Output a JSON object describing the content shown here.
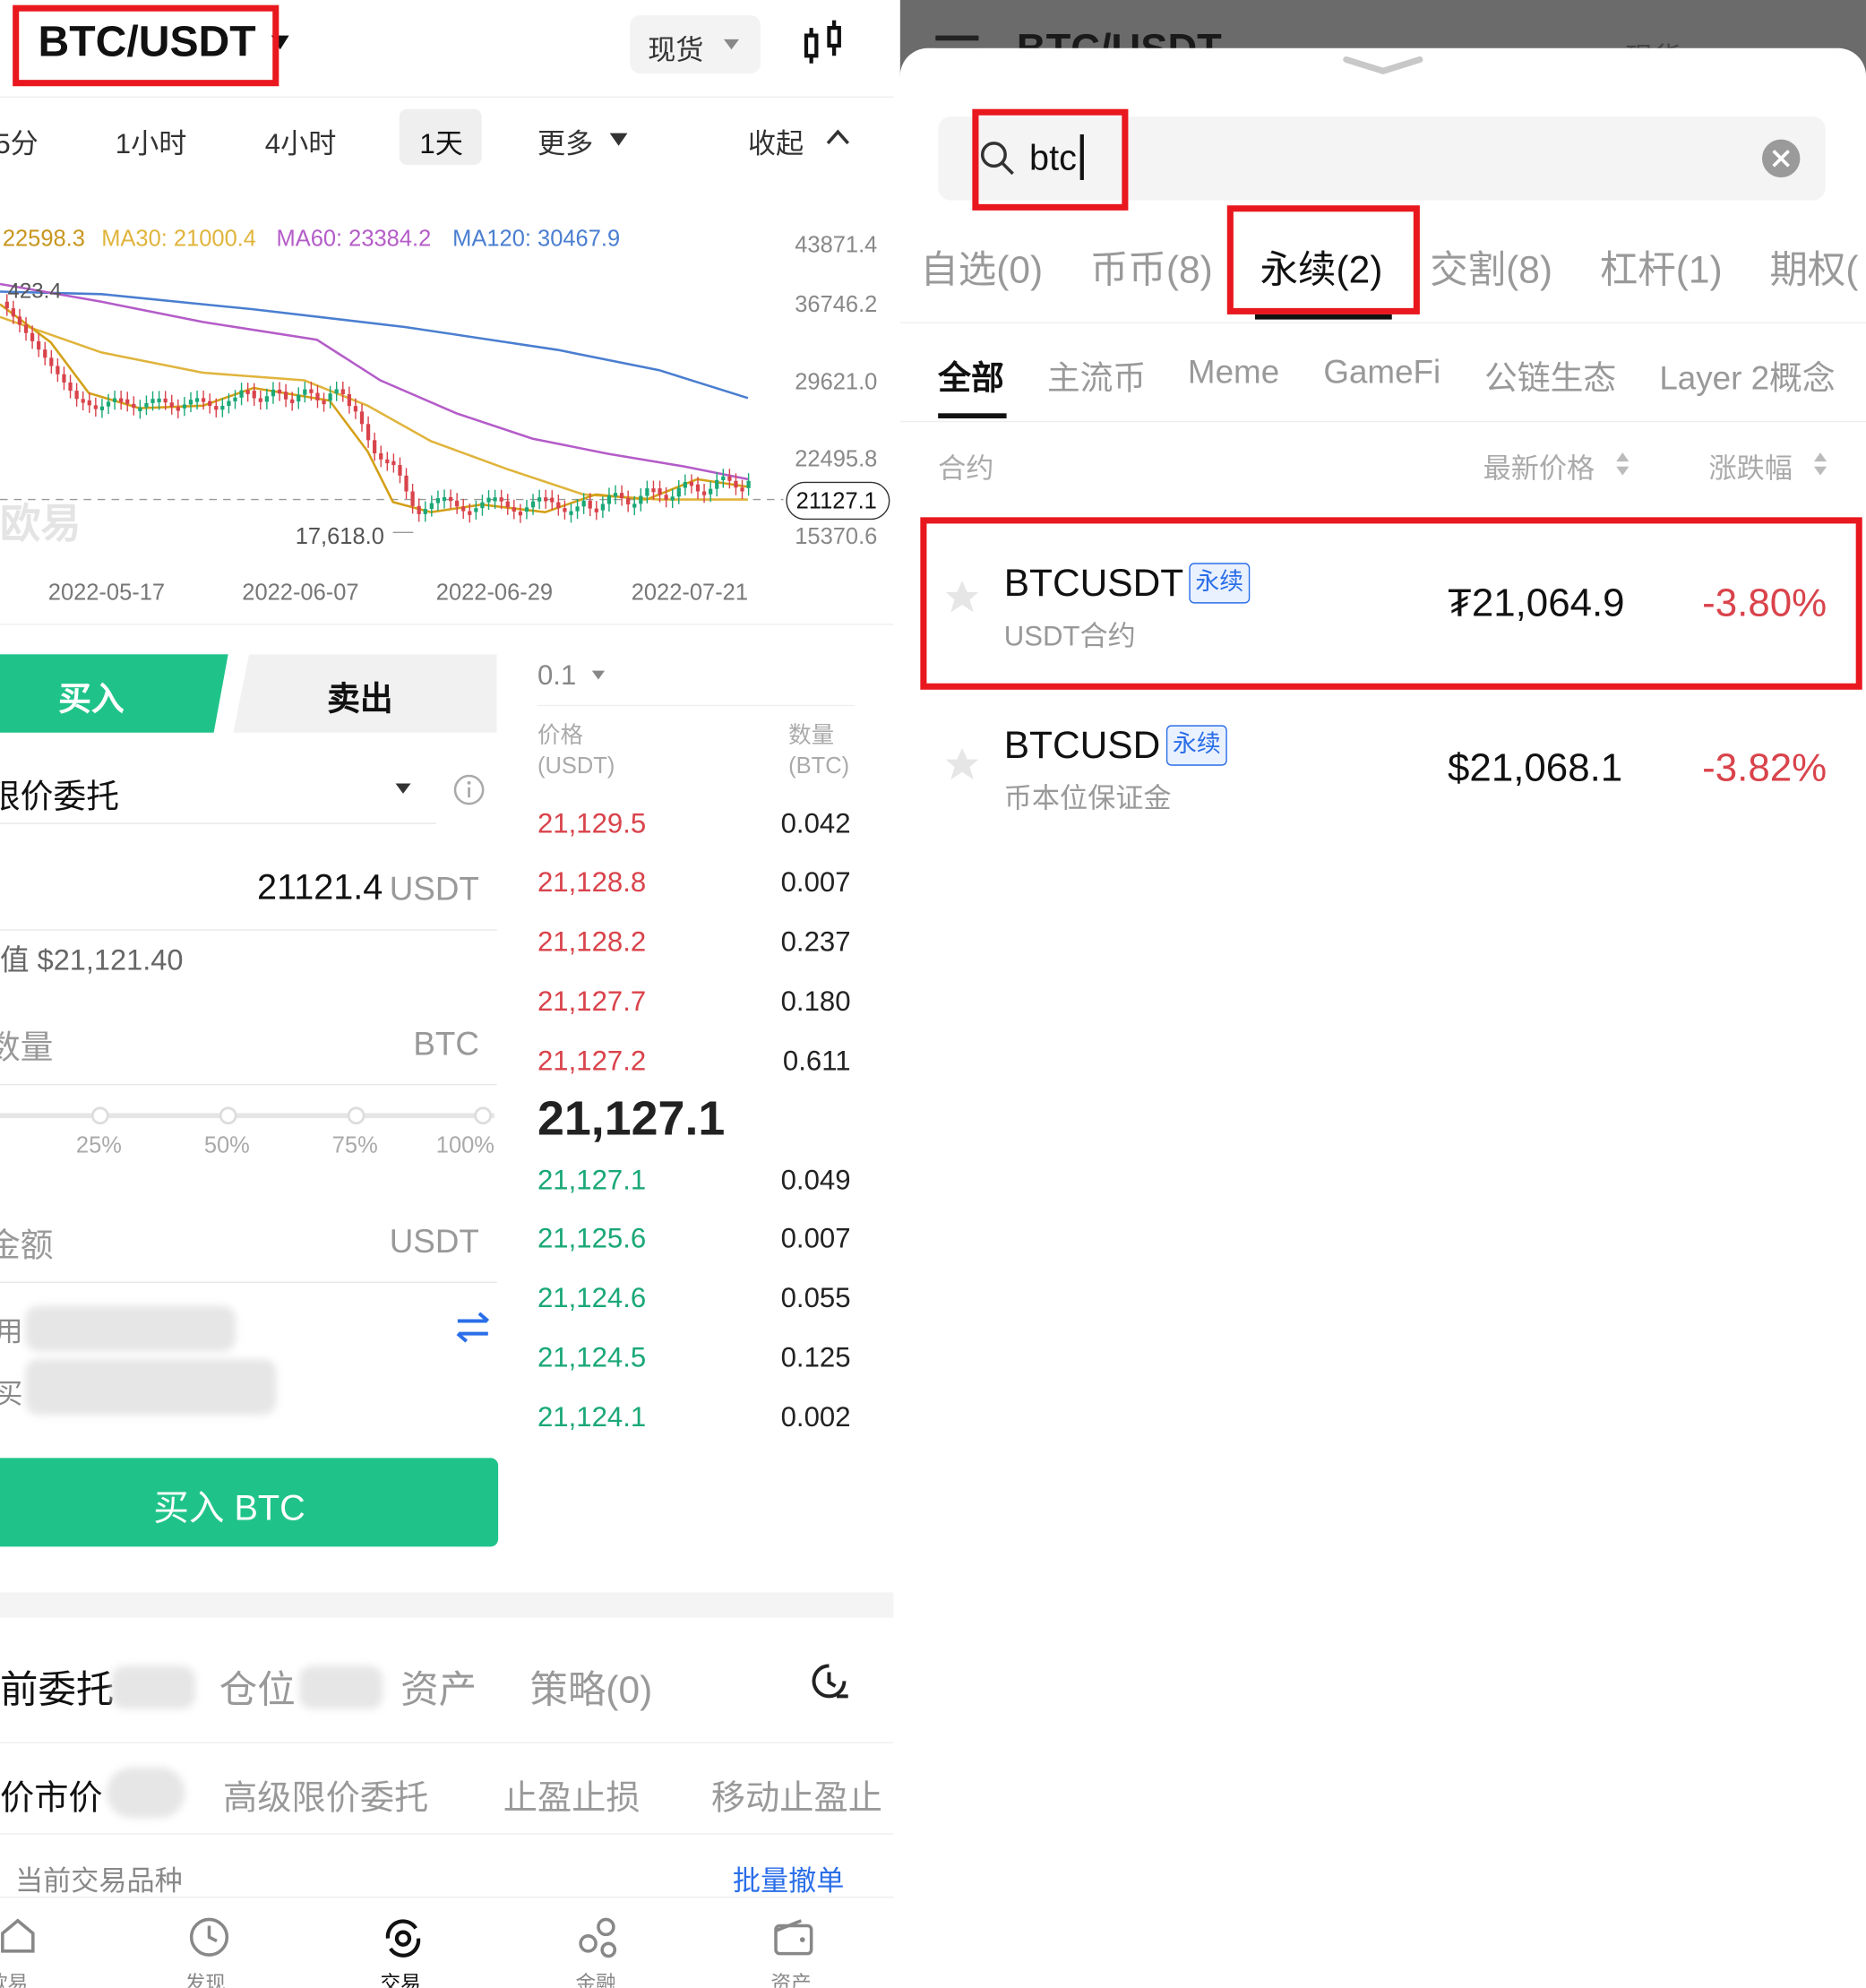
{
  "left": {
    "pair": "BTC/USDT",
    "market_type": "现货",
    "intervals": [
      "5分",
      "1小时",
      "4小时",
      "1天",
      "更多",
      "收起"
    ],
    "active_interval": "1天",
    "ma": {
      "ma_first": "22598.3",
      "ma30": "MA30: 21000.4",
      "ma60": "MA60: 23384.2",
      "ma120": "MA120: 30467.9"
    },
    "chart_data": {
      "type": "candlestick",
      "price_ticks": [
        "43871.4",
        "36746.2",
        "29621.0",
        "22495.8",
        "15370.6"
      ],
      "date_ticks": [
        "2022-05-17",
        "2022-06-07",
        "2022-06-29",
        "2022-07-21"
      ],
      "high_label": "423.4",
      "low_label": "17,618.0",
      "current_price": "21127.1",
      "watermark": "欧易",
      "colors": {
        "ma_first": "#d4a017",
        "ma30": "#e0b43c",
        "ma60": "#b45cc8",
        "ma120": "#4a7ed0",
        "up": "#1aa876",
        "down": "#d9434b"
      }
    },
    "trade": {
      "buy_tab": "买入",
      "sell_tab": "卖出",
      "order_type": "限价委托",
      "price_value": "21121.4",
      "price_unit": "USDT",
      "approx_value": "值 $21,121.40",
      "amount_placeholder": "数量",
      "amount_unit": "BTC",
      "percent_marks": [
        "25%",
        "50%",
        "75%",
        "100%"
      ],
      "total_placeholder": "金额",
      "total_unit": "USDT",
      "available_label": "用",
      "max_buy_label": "买",
      "buy_button": "买入 BTC"
    },
    "orderbook": {
      "precision": "0.1",
      "price_header": "价格",
      "price_unit": "(USDT)",
      "qty_header": "数量",
      "qty_unit": "(BTC)",
      "asks": [
        {
          "price": "21,129.5",
          "qty": "0.042"
        },
        {
          "price": "21,128.8",
          "qty": "0.007"
        },
        {
          "price": "21,128.2",
          "qty": "0.237"
        },
        {
          "price": "21,127.7",
          "qty": "0.180"
        },
        {
          "price": "21,127.2",
          "qty": "0.611"
        }
      ],
      "last_price": "21,127.1",
      "bids": [
        {
          "price": "21,127.1",
          "qty": "0.049"
        },
        {
          "price": "21,125.6",
          "qty": "0.007"
        },
        {
          "price": "21,124.6",
          "qty": "0.055"
        },
        {
          "price": "21,124.5",
          "qty": "0.125"
        },
        {
          "price": "21,124.1",
          "qty": "0.002"
        }
      ]
    },
    "bottom_tabs": [
      "前委托",
      "仓位",
      "资产",
      "策略(0)"
    ],
    "order_filters": [
      "价市价",
      "高级限价委托",
      "止盈止损",
      "移动止盈止"
    ],
    "current_pair_label": "当前交易品种",
    "batch_cancel": "批量撤单",
    "nav": [
      "欧易",
      "发现",
      "交易",
      "金融",
      "资产"
    ]
  },
  "right": {
    "bg_title": "BTC/USDT",
    "bg_market": "现货",
    "search_value": "btc",
    "category_tabs": [
      "自选(0)",
      "币币(8)",
      "永续(2)",
      "交割(8)",
      "杠杆(1)",
      "期权("
    ],
    "active_category": "永续(2)",
    "sub_tabs": [
      "全部",
      "主流币",
      "Meme",
      "GameFi",
      "公链生态",
      "Layer 2概念"
    ],
    "active_sub_tab": "全部",
    "col_contract": "合约",
    "col_price": "最新价格",
    "col_change": "涨跌幅",
    "rows": [
      {
        "symbol": "BTCUSDT",
        "tag": "永续",
        "sub": "USDT合约",
        "price": "₮21,064.9",
        "change": "-3.80%"
      },
      {
        "symbol": "BTCUSD",
        "tag": "永续",
        "sub": "币本位保证金",
        "price": "$21,068.1",
        "change": "-3.82%"
      }
    ]
  }
}
